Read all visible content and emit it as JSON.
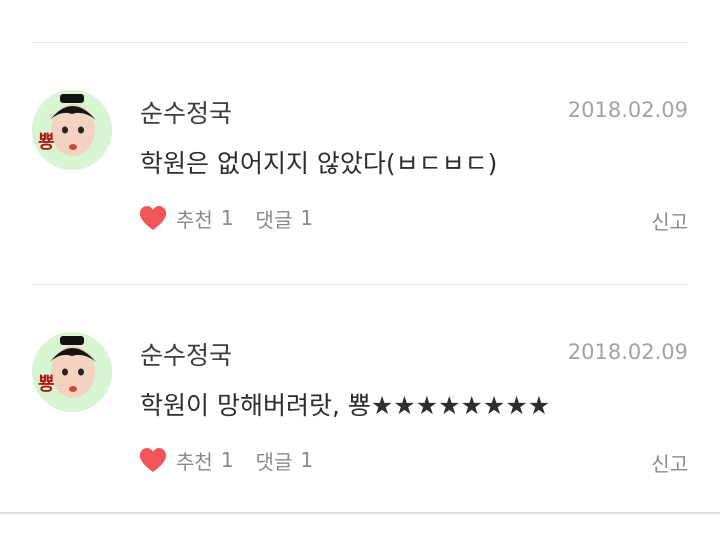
{
  "comments": [
    {
      "author": "순수정국",
      "date": "2018.02.09",
      "text": "학원은 없어지지 않았다(ㅂㄷㅂㄷ)",
      "like_label": "추천",
      "like_count": "1",
      "reply_label": "댓글",
      "reply_count": "1",
      "report_label": "신고",
      "avatar_badge": "뿅"
    },
    {
      "author": "순수정국",
      "date": "2018.02.09",
      "text": "학원이 망해버려랏, 뿅★★★★★★★★",
      "like_label": "추천",
      "like_count": "1",
      "reply_label": "댓글",
      "reply_count": "1",
      "report_label": "신고",
      "avatar_badge": "뿅"
    }
  ],
  "colors": {
    "heart": "#f2545b",
    "avatar_bg": "#d8f5d2"
  },
  "icons": [
    "avatar-image",
    "heart-icon"
  ]
}
